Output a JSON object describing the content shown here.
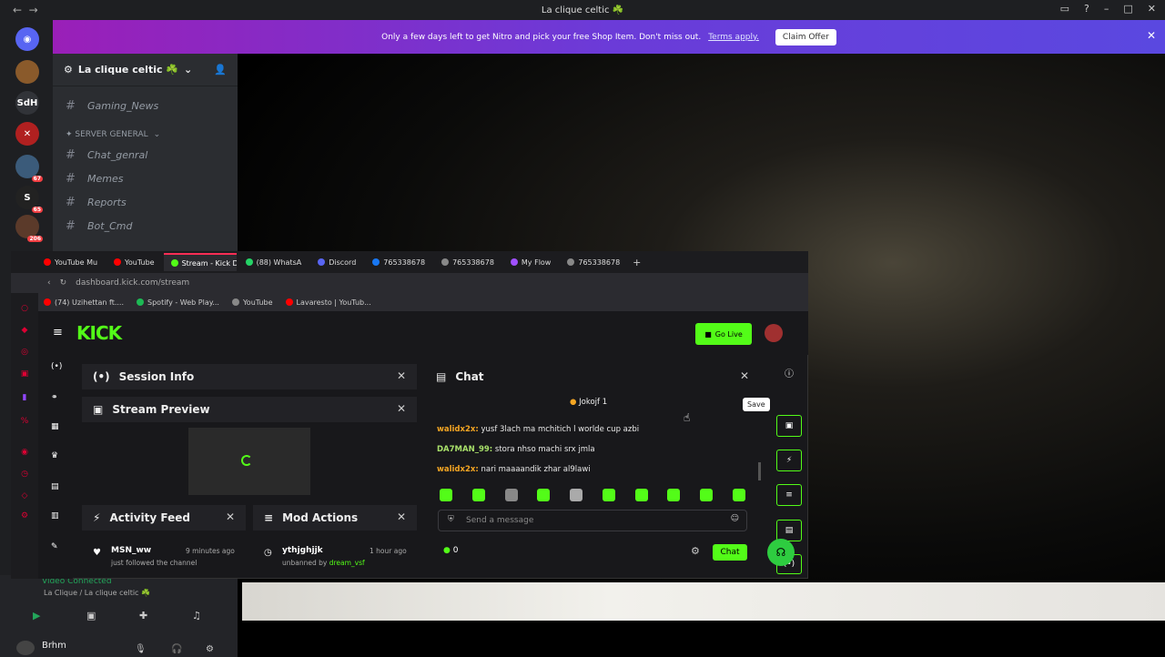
{
  "discord": {
    "window_title": "La clique celtic ☘️",
    "banner": {
      "text": "Only a few days left to get Nitro and pick your free Shop Item. Don't miss out.",
      "link": "Terms apply.",
      "button": "Claim Offer"
    },
    "server_name": "La clique celtic ☘️",
    "guild_labels": [
      "SdH"
    ],
    "guild_badges": [
      "67",
      "65",
      "206"
    ],
    "channels": [
      {
        "name": "Gaming_News"
      },
      {
        "name": "Chat_genral"
      },
      {
        "name": "Memes"
      },
      {
        "name": "Reports"
      },
      {
        "name": "Bot_Cmd"
      }
    ],
    "category": "✦ SERVER GENERAL",
    "voice": {
      "status": "Video Connected",
      "channel": "La Clique / La clique celtic ☘️"
    },
    "user": {
      "name": "Brhm"
    }
  },
  "browser": {
    "tabs": [
      "YouTube Mu",
      "YouTube",
      "Stream - Kick Dashb",
      "(88) WhatsA",
      "Discord",
      "765338678",
      "765338678",
      "My Flow",
      "765338678"
    ],
    "url": "dashboard.kick.com/stream",
    "bookmarks": [
      "(74) Uzihettan ft....",
      "Spotify - Web Play...",
      "YouTube",
      "Lavaresto | YouTub..."
    ]
  },
  "kick": {
    "logo": "KICK",
    "go_live": "Go Live",
    "session_info": "Session Info",
    "stream_preview": "Stream Preview",
    "activity_feed": "Activity Feed",
    "mod_actions": "Mod Actions",
    "activity_item": {
      "user": "MSN_ww",
      "time": "9 minutes ago",
      "text": "just followed the channel"
    },
    "mod_item": {
      "user": "ythjghjjk",
      "time": "1 hour ago",
      "text": "unbanned by",
      "by": "dream_vsf"
    },
    "chat": {
      "title": "Chat",
      "pinned": "Jokojf 1",
      "messages": [
        {
          "user": "walidx2x:",
          "text": "yusf 3lach ma mchitich l worlde cup azbi",
          "color": "#f5a623"
        },
        {
          "user": "DA7MAN_99:",
          "text": "stora nhso machi srx jmla",
          "color": "#a8e06a"
        },
        {
          "user": "walidx2x:",
          "text": "nari maaaandik zhar al9lawi",
          "color": "#f5a623"
        }
      ],
      "placeholder": "Send a message",
      "count": "0",
      "send": "Chat",
      "tooltip": "Save"
    }
  }
}
